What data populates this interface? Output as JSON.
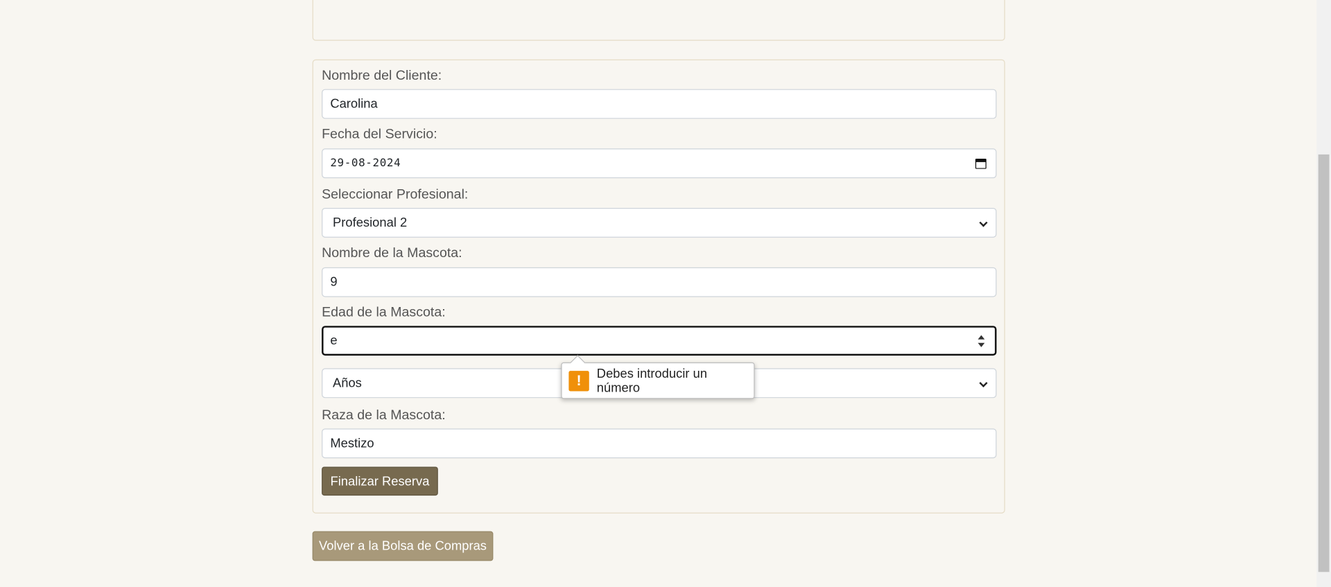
{
  "form": {
    "client_label": "Nombre del Cliente:",
    "client_value": "Carolina",
    "date_label": "Fecha del Servicio:",
    "date_value": "29-08-2024",
    "professional_label": "Seleccionar Profesional:",
    "professional_value": "Profesional 2",
    "pet_name_label": "Nombre de la Mascota:",
    "pet_name_value": "9",
    "pet_age_label": "Edad de la Mascota:",
    "pet_age_value": "e",
    "age_unit_value": "Años",
    "breed_label": "Raza de la Mascota:",
    "breed_value": "Mestizo",
    "submit_label": "Finalizar Reserva"
  },
  "validation": {
    "message": "Debes introducir un número",
    "icon": "warning-icon",
    "color": "#f0900a"
  },
  "back_button_label": "Volver a la Bolsa de Compras",
  "colors": {
    "background": "#f8f6f1",
    "primary_button": "#776a4f",
    "secondary_button": "#a8997a"
  }
}
